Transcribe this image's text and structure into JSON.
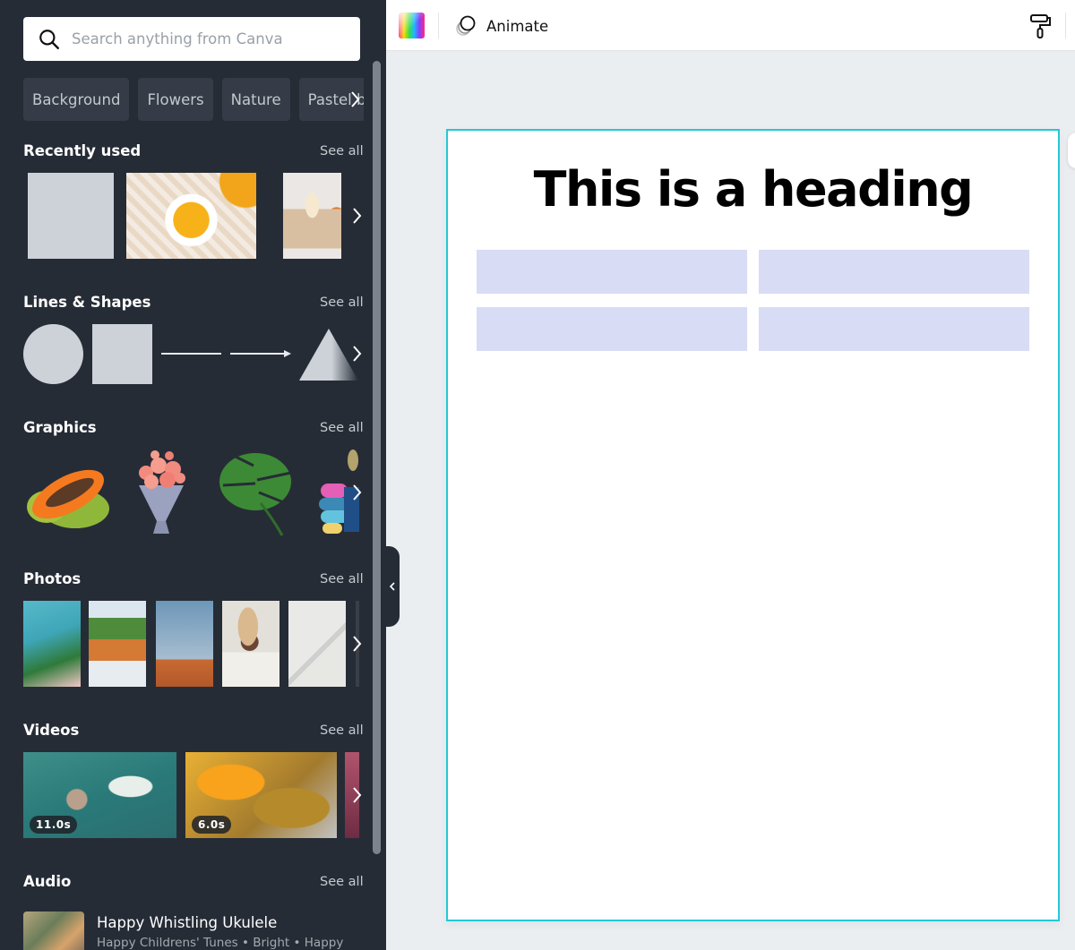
{
  "sidebar": {
    "search": {
      "placeholder": "Search anything from Canva",
      "value": ""
    },
    "chips": [
      "Background",
      "Flowers",
      "Nature",
      "Pastel b"
    ],
    "sections": {
      "recently_used": {
        "title": "Recently used",
        "see_all": "See all"
      },
      "lines_shapes": {
        "title": "Lines & Shapes",
        "see_all": "See all"
      },
      "graphics": {
        "title": "Graphics",
        "see_all": "See all"
      },
      "photos": {
        "title": "Photos",
        "see_all": "See all"
      },
      "videos": {
        "title": "Videos",
        "see_all": "See all",
        "items": [
          {
            "duration": "11.0s"
          },
          {
            "duration": "6.0s"
          }
        ]
      },
      "audio": {
        "title": "Audio",
        "see_all": "See all",
        "items": [
          {
            "title": "Happy Whistling Ukulele",
            "subtitle": "Happy Childrens' Tunes • Bright • Happy"
          }
        ]
      }
    }
  },
  "toolbar": {
    "animate_label": "Animate"
  },
  "canvas": {
    "heading": "This is a heading",
    "border_color": "#22c9d6",
    "cell_color": "#d8dcf5"
  }
}
